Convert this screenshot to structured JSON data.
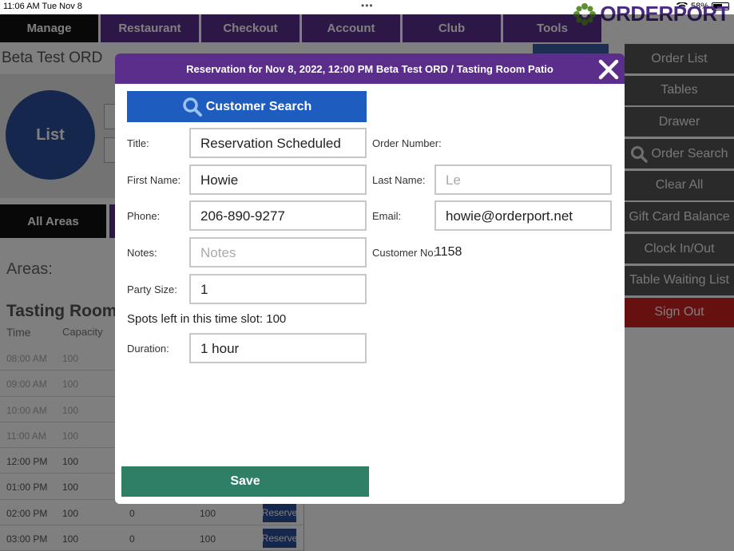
{
  "status_bar": {
    "time": "11:06 AM",
    "date": "Tue Nov 8",
    "battery": "58%"
  },
  "nav": {
    "tabs": [
      "Manage",
      "Restaurant",
      "Checkout",
      "Account",
      "Club",
      "Tools"
    ],
    "logo_text": "ORDERPORT"
  },
  "background": {
    "title": "Beta Test ORD",
    "list_label": "List",
    "all_areas": "All Areas",
    "areas_label": "Areas:",
    "room_title": "Tasting Room P",
    "col_time": "Time",
    "col_capacity": "Capacity",
    "rows": [
      {
        "time": "08:00 AM",
        "capacity": "100",
        "booked": "",
        "left": ""
      },
      {
        "time": "09:00 AM",
        "capacity": "100",
        "booked": "",
        "left": ""
      },
      {
        "time": "10:00 AM",
        "capacity": "100",
        "booked": "",
        "left": ""
      },
      {
        "time": "11:00 AM",
        "capacity": "100",
        "booked": "",
        "left": ""
      },
      {
        "time": "12:00 PM",
        "capacity": "100",
        "booked": "",
        "left": ""
      },
      {
        "time": "01:00 PM",
        "capacity": "100",
        "booked": "",
        "left": ""
      },
      {
        "time": "02:00 PM",
        "capacity": "100",
        "booked": "0",
        "left": "100",
        "action": "Reserve"
      },
      {
        "time": "03:00 PM",
        "capacity": "100",
        "booked": "0",
        "left": "100",
        "action": "Reserve"
      }
    ]
  },
  "sidebar": {
    "items": [
      "Order List",
      "Tables",
      "Drawer",
      "Order Search",
      "Clear All",
      "Gift Card Balance",
      "Clock In/Out",
      "Table Waiting List",
      "Sign Out"
    ]
  },
  "modal": {
    "header": "Reservation for Nov 8, 2022, 12:00 PM Beta Test ORD / Tasting Room Patio",
    "customer_search": "Customer Search",
    "title_label": "Title:",
    "title_value": "Reservation Scheduled",
    "order_number_label": "Order Number:",
    "first_name_label": "First Name:",
    "first_name_value": "Howie",
    "last_name_label": "Last Name:",
    "last_name_value": "Le",
    "phone_label": "Phone:",
    "phone_value": "206-890-9277",
    "email_label": "Email:",
    "email_value": "howie@orderport.net",
    "notes_label": "Notes:",
    "notes_placeholder": "Notes",
    "customer_no_label": "Customer No:",
    "customer_no_value": "1158",
    "party_size_label": "Party Size:",
    "party_size_value": "1",
    "spots_left_text": "Spots left in this time slot: 100",
    "duration_label": "Duration:",
    "duration_value": "1 hour",
    "save_label": "Save"
  },
  "colors": {
    "nav_purple": "#5b2e8c",
    "search_blue": "#1f5cbf",
    "save_green": "#2e7f66",
    "signout_red": "#cc2020"
  }
}
